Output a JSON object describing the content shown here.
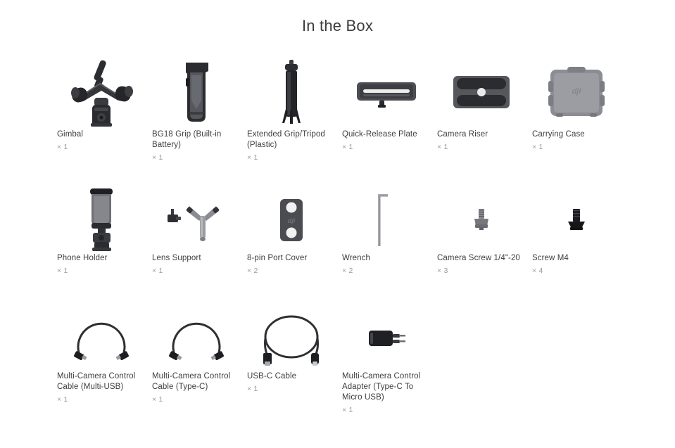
{
  "page": {
    "title": "In the Box",
    "background_color": "#ffffff",
    "text_color": "#3d3d3d",
    "qty_color": "#9a9a9a"
  },
  "rows": [
    {
      "items": [
        {
          "name": "Gimbal",
          "qty": "× 1",
          "icon": "gimbal-icon"
        },
        {
          "name": "BG18 Grip (Built-in Battery)",
          "qty": "× 1",
          "icon": "grip-icon"
        },
        {
          "name": "Extended Grip/Tripod (Plastic)",
          "qty": "× 1",
          "icon": "tripod-icon"
        },
        {
          "name": "Quick-Release Plate",
          "qty": "× 1",
          "icon": "quick-release-plate-icon"
        },
        {
          "name": "Camera Riser",
          "qty": "× 1",
          "icon": "camera-riser-icon"
        },
        {
          "name": "Carrying Case",
          "qty": "× 1",
          "icon": "carrying-case-icon"
        }
      ]
    },
    {
      "items": [
        {
          "name": "Phone Holder",
          "qty": "× 1",
          "icon": "phone-holder-icon"
        },
        {
          "name": "Lens Support",
          "qty": "× 1",
          "icon": "lens-support-icon"
        },
        {
          "name": "8-pin Port Cover",
          "qty": "× 2",
          "icon": "port-cover-icon"
        },
        {
          "name": "Wrench",
          "qty": "× 2",
          "icon": "wrench-icon"
        },
        {
          "name": "Camera Screw 1/4\"-20",
          "qty": "× 3",
          "icon": "camera-screw-icon"
        },
        {
          "name": "Screw M4",
          "qty": "× 4",
          "icon": "screw-m4-icon"
        }
      ]
    },
    {
      "items": [
        {
          "name": "Multi-Camera Control Cable (Multi-USB)",
          "qty": "× 1",
          "icon": "control-cable-multi-usb-icon"
        },
        {
          "name": "Multi-Camera Control Cable (Type-C)",
          "qty": "× 1",
          "icon": "control-cable-type-c-icon"
        },
        {
          "name": "USB-C Cable",
          "qty": "× 1",
          "icon": "usb-c-cable-icon"
        },
        {
          "name": "Multi-Camera Control Adapter (Type-C To Micro USB)",
          "qty": "× 1",
          "icon": "control-adapter-icon"
        }
      ]
    }
  ]
}
